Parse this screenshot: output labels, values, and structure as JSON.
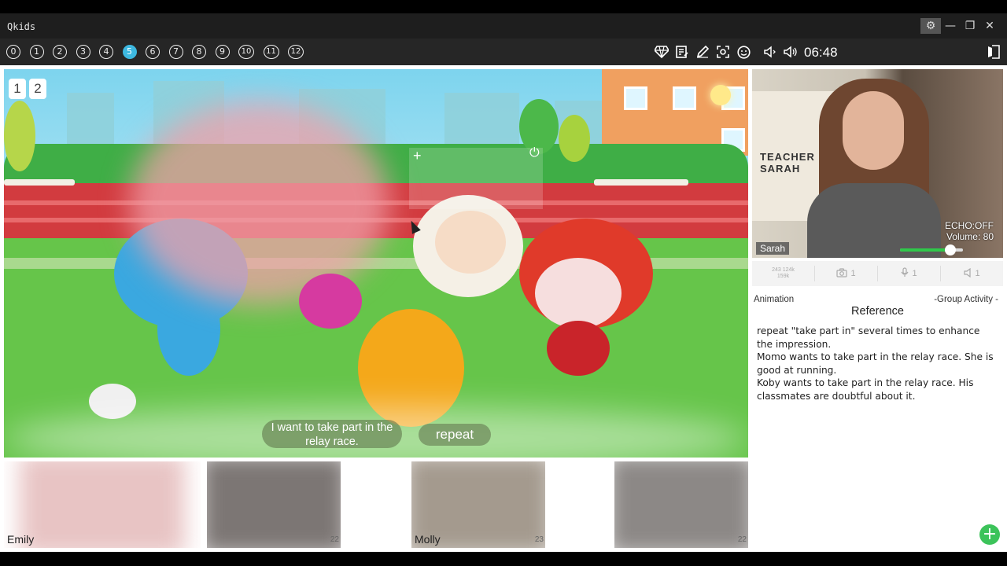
{
  "window": {
    "title": "Qkids",
    "gear_icon": "⚙",
    "minimize_icon": "—",
    "maximize_icon": "❐",
    "close_icon": "✕"
  },
  "toolbar": {
    "pages": [
      "0",
      "1",
      "2",
      "3",
      "4",
      "5",
      "6",
      "7",
      "8",
      "9",
      "10",
      "11",
      "12"
    ],
    "active_page": "5",
    "timer": "06:48",
    "tools": [
      "diamond-icon",
      "notes-icon",
      "pen-icon",
      "focus-icon",
      "smile-icon",
      "speaker-low-icon",
      "speaker-high-icon"
    ]
  },
  "slide": {
    "page_tabs": [
      "1",
      "2"
    ],
    "caption": "I want to take part in the relay race.",
    "repeat_label": "repeat"
  },
  "teacher": {
    "name": "Sarah",
    "poster": "TEACHER SARAH",
    "echo": "ECHO:OFF",
    "volume_text": "Volume: 80",
    "volume": 80
  },
  "stats": {
    "signal_lines": [
      "243  124k",
      "159k"
    ],
    "camera": "1",
    "mic": "1",
    "speaker": "1"
  },
  "reference": {
    "tab": "Animation",
    "group": "-Group Activity -",
    "title": "Reference",
    "lines": [
      "repeat \"take part in\" several times to enhance the impression.",
      "Momo wants to take part in the relay race. She is good at running.",
      "Koby wants to take part in the relay race. His classmates are doubtful about it."
    ]
  },
  "students": [
    {
      "name": "Emily",
      "badge": ""
    },
    {
      "name": "",
      "badge": "22"
    },
    {
      "name": "Molly",
      "badge": "23"
    },
    {
      "name": "",
      "badge": "22"
    }
  ],
  "colors": {
    "accent": "#3db8e0",
    "add_button": "#3cc35a",
    "volume_fill": "#2fc84a"
  }
}
